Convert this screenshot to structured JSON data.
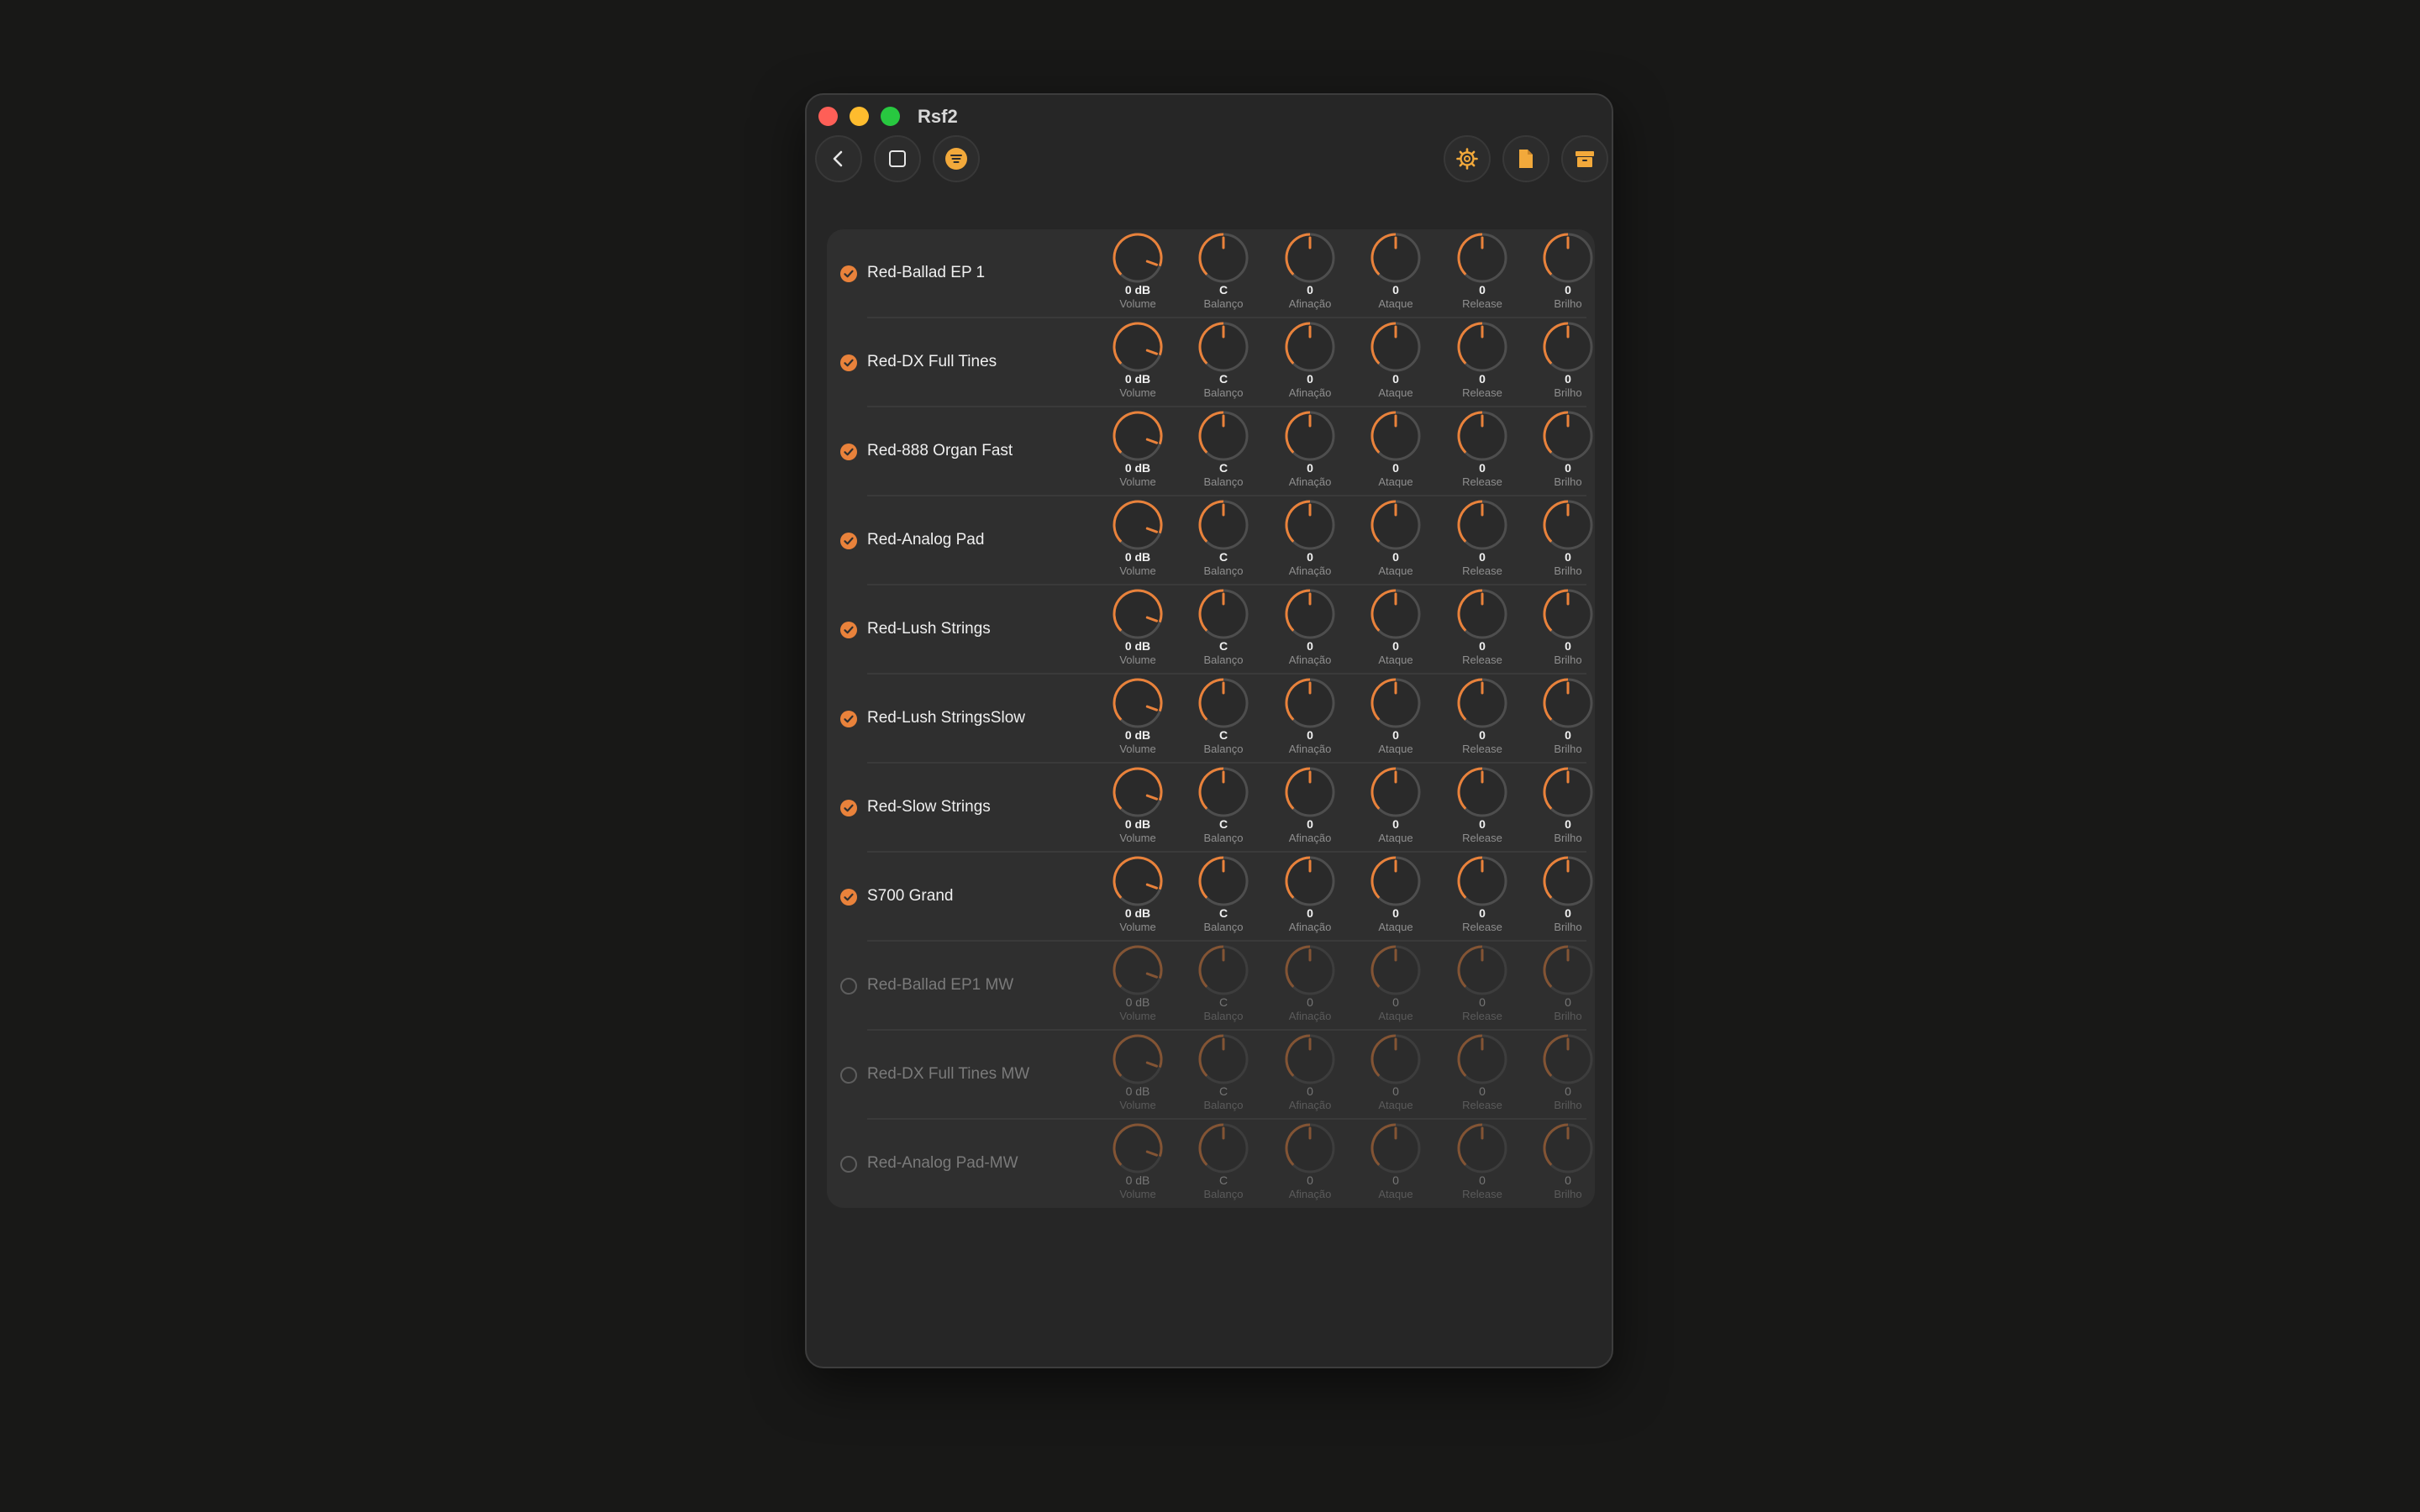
{
  "window": {
    "title": "Rsf2"
  },
  "toolbar": {
    "left_icons": [
      "back-chevron-icon",
      "square-icon",
      "lines-circle-icon"
    ],
    "right_icons": [
      "gear-icon",
      "document-icon",
      "archive-box-icon"
    ]
  },
  "colors": {
    "accent": "#e9823b",
    "background": "#262626",
    "panel": "#2f2f2f"
  },
  "knob_labels": [
    "Volume",
    "Balanço",
    "Afinação",
    "Ataque",
    "Release",
    "Brilho"
  ],
  "presets": [
    {
      "name": "Red-Ballad EP 1",
      "enabled": true,
      "values": [
        "0 dB",
        "C",
        "0",
        "0",
        "0",
        "0"
      ]
    },
    {
      "name": "Red-DX Full Tines",
      "enabled": true,
      "values": [
        "0 dB",
        "C",
        "0",
        "0",
        "0",
        "0"
      ]
    },
    {
      "name": "Red-888 Organ Fast",
      "enabled": true,
      "values": [
        "0 dB",
        "C",
        "0",
        "0",
        "0",
        "0"
      ]
    },
    {
      "name": "Red-Analog Pad",
      "enabled": true,
      "values": [
        "0 dB",
        "C",
        "0",
        "0",
        "0",
        "0"
      ]
    },
    {
      "name": "Red-Lush Strings",
      "enabled": true,
      "values": [
        "0 dB",
        "C",
        "0",
        "0",
        "0",
        "0"
      ]
    },
    {
      "name": "Red-Lush StringsSlow",
      "enabled": true,
      "values": [
        "0 dB",
        "C",
        "0",
        "0",
        "0",
        "0"
      ]
    },
    {
      "name": "Red-Slow Strings",
      "enabled": true,
      "values": [
        "0 dB",
        "C",
        "0",
        "0",
        "0",
        "0"
      ]
    },
    {
      "name": "S700 Grand",
      "enabled": true,
      "values": [
        "0 dB",
        "C",
        "0",
        "0",
        "0",
        "0"
      ]
    },
    {
      "name": "Red-Ballad EP1 MW",
      "enabled": false,
      "values": [
        "0 dB",
        "C",
        "0",
        "0",
        "0",
        "0"
      ]
    },
    {
      "name": "Red-DX Full Tines MW",
      "enabled": false,
      "values": [
        "0 dB",
        "C",
        "0",
        "0",
        "0",
        "0"
      ]
    },
    {
      "name": "Red-Analog Pad-MW",
      "enabled": false,
      "values": [
        "0 dB",
        "C",
        "0",
        "0",
        "0",
        "0"
      ]
    }
  ]
}
